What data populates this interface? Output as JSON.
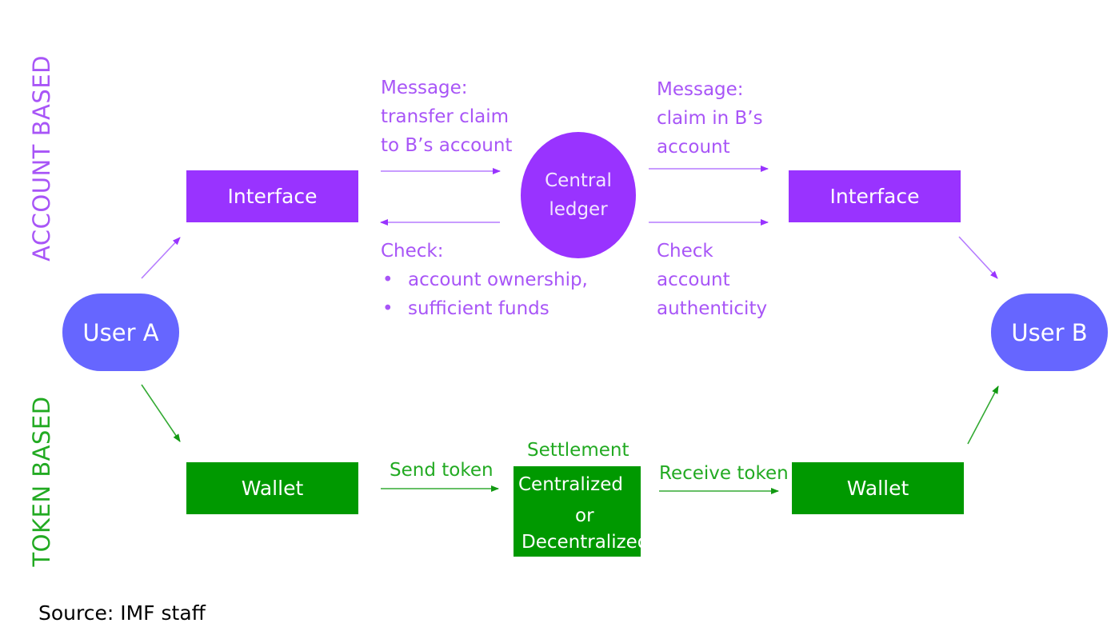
{
  "sections": {
    "account_label": "ACCOUNT BASED",
    "token_label": "TOKEN BASED"
  },
  "nodes": {
    "user_a": "User A",
    "user_b": "User B",
    "interface_left": "Interface",
    "interface_right": "Interface",
    "central_ledger": [
      "Central",
      "ledger"
    ],
    "wallet_left": "Wallet",
    "wallet_right": "Wallet",
    "settlement": {
      "title": "Settlement",
      "lines": [
        "Centralized",
        "or",
        "Decentralized"
      ]
    }
  },
  "account_annotations": {
    "message_left": [
      "Message:",
      "transfer claim",
      "to B’s account"
    ],
    "message_right": [
      "Message:",
      "claim in B’s",
      "account"
    ],
    "check_left": {
      "title": "Check:",
      "bullets": [
        "account ownership,",
        "sufficient funds"
      ]
    },
    "check_right": [
      "Check",
      "account",
      "authenticity"
    ]
  },
  "token_annotations": {
    "send": "Send token",
    "receive": "Receive token"
  },
  "source": "Source: IMF staff",
  "colors": {
    "account_purple": "#9933ff",
    "account_text": "#a855f7",
    "user_node": "#6666ff",
    "token_green": "#009900",
    "token_text": "#22aa22"
  }
}
